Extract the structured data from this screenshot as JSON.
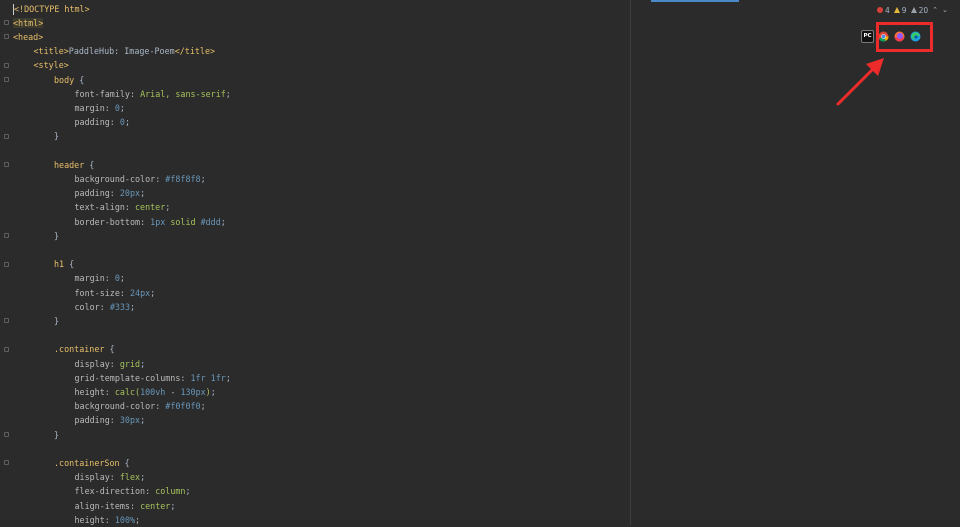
{
  "editor": {
    "lines": [
      {
        "indent": 0,
        "tokens": [
          {
            "t": "<!DOCTYPE html>",
            "c": "t-doc"
          }
        ],
        "cursor": true
      },
      {
        "indent": 0,
        "tokens": [
          {
            "t": "<html>",
            "c": "t-tagbg"
          }
        ]
      },
      {
        "indent": 0,
        "tokens": [
          {
            "t": "<head>",
            "c": "t-tag"
          }
        ]
      },
      {
        "indent": 1,
        "tokens": [
          {
            "t": "<title>",
            "c": "t-tag"
          },
          {
            "t": "PaddleHub: Image-Poem",
            "c": "t-plain"
          },
          {
            "t": "</title>",
            "c": "t-tag"
          }
        ]
      },
      {
        "indent": 1,
        "tokens": [
          {
            "t": "<style>",
            "c": "t-tag"
          }
        ]
      },
      {
        "indent": 2,
        "tokens": [
          {
            "t": "body",
            "c": "t-sel"
          },
          {
            "t": " {",
            "c": "t-plain"
          }
        ]
      },
      {
        "indent": 3,
        "tokens": [
          {
            "t": "font-family",
            "c": "t-prop"
          },
          {
            "t": ": ",
            "c": "t-plain"
          },
          {
            "t": "Arial, sans-serif",
            "c": "t-val"
          },
          {
            "t": ";",
            "c": "t-plain"
          }
        ]
      },
      {
        "indent": 3,
        "tokens": [
          {
            "t": "margin",
            "c": "t-prop"
          },
          {
            "t": ": ",
            "c": "t-plain"
          },
          {
            "t": "0",
            "c": "t-num"
          },
          {
            "t": ";",
            "c": "t-plain"
          }
        ]
      },
      {
        "indent": 3,
        "tokens": [
          {
            "t": "padding",
            "c": "t-prop"
          },
          {
            "t": ": ",
            "c": "t-plain"
          },
          {
            "t": "0",
            "c": "t-num"
          },
          {
            "t": ";",
            "c": "t-plain"
          }
        ]
      },
      {
        "indent": 2,
        "tokens": [
          {
            "t": "}",
            "c": "t-plain"
          }
        ]
      },
      {
        "indent": 0,
        "tokens": []
      },
      {
        "indent": 2,
        "tokens": [
          {
            "t": "header",
            "c": "t-sel"
          },
          {
            "t": " {",
            "c": "t-plain"
          }
        ]
      },
      {
        "indent": 3,
        "tokens": [
          {
            "t": "background-color",
            "c": "t-prop"
          },
          {
            "t": ": ",
            "c": "t-plain"
          },
          {
            "t": "#f8f8f8",
            "c": "t-num"
          },
          {
            "t": ";",
            "c": "t-plain"
          }
        ]
      },
      {
        "indent": 3,
        "tokens": [
          {
            "t": "padding",
            "c": "t-prop"
          },
          {
            "t": ": ",
            "c": "t-plain"
          },
          {
            "t": "20px",
            "c": "t-num"
          },
          {
            "t": ";",
            "c": "t-plain"
          }
        ]
      },
      {
        "indent": 3,
        "tokens": [
          {
            "t": "text-align",
            "c": "t-prop"
          },
          {
            "t": ": ",
            "c": "t-plain"
          },
          {
            "t": "center",
            "c": "t-val"
          },
          {
            "t": ";",
            "c": "t-plain"
          }
        ]
      },
      {
        "indent": 3,
        "tokens": [
          {
            "t": "border-bottom",
            "c": "t-prop"
          },
          {
            "t": ": ",
            "c": "t-plain"
          },
          {
            "t": "1px",
            "c": "t-num"
          },
          {
            "t": " solid ",
            "c": "t-val"
          },
          {
            "t": "#ddd",
            "c": "t-num"
          },
          {
            "t": ";",
            "c": "t-plain"
          }
        ]
      },
      {
        "indent": 2,
        "tokens": [
          {
            "t": "}",
            "c": "t-plain"
          }
        ]
      },
      {
        "indent": 0,
        "tokens": []
      },
      {
        "indent": 2,
        "tokens": [
          {
            "t": "h1",
            "c": "t-sel"
          },
          {
            "t": " {",
            "c": "t-plain"
          }
        ]
      },
      {
        "indent": 3,
        "tokens": [
          {
            "t": "margin",
            "c": "t-prop"
          },
          {
            "t": ": ",
            "c": "t-plain"
          },
          {
            "t": "0",
            "c": "t-num"
          },
          {
            "t": ";",
            "c": "t-plain"
          }
        ]
      },
      {
        "indent": 3,
        "tokens": [
          {
            "t": "font-size",
            "c": "t-prop"
          },
          {
            "t": ": ",
            "c": "t-plain"
          },
          {
            "t": "24px",
            "c": "t-num"
          },
          {
            "t": ";",
            "c": "t-plain"
          }
        ]
      },
      {
        "indent": 3,
        "tokens": [
          {
            "t": "color",
            "c": "t-prop"
          },
          {
            "t": ": ",
            "c": "t-plain"
          },
          {
            "t": "#333",
            "c": "t-num"
          },
          {
            "t": ";",
            "c": "t-plain"
          }
        ]
      },
      {
        "indent": 2,
        "tokens": [
          {
            "t": "}",
            "c": "t-plain"
          }
        ]
      },
      {
        "indent": 0,
        "tokens": []
      },
      {
        "indent": 2,
        "tokens": [
          {
            "t": ".container",
            "c": "t-sel"
          },
          {
            "t": " {",
            "c": "t-plain"
          }
        ]
      },
      {
        "indent": 3,
        "tokens": [
          {
            "t": "display",
            "c": "t-prop"
          },
          {
            "t": ": ",
            "c": "t-plain"
          },
          {
            "t": "grid",
            "c": "t-val"
          },
          {
            "t": ";",
            "c": "t-plain"
          }
        ]
      },
      {
        "indent": 3,
        "tokens": [
          {
            "t": "grid-template-columns",
            "c": "t-prop"
          },
          {
            "t": ": ",
            "c": "t-plain"
          },
          {
            "t": "1fr",
            "c": "t-num"
          },
          {
            "t": " ",
            "c": "t-plain"
          },
          {
            "t": "1fr",
            "c": "t-num"
          },
          {
            "t": ";",
            "c": "t-plain"
          }
        ]
      },
      {
        "indent": 3,
        "tokens": [
          {
            "t": "height",
            "c": "t-prop"
          },
          {
            "t": ": ",
            "c": "t-plain"
          },
          {
            "t": "calc(",
            "c": "t-val"
          },
          {
            "t": "100vh",
            "c": "t-num"
          },
          {
            "t": " - ",
            "c": "t-plain"
          },
          {
            "t": "130px",
            "c": "t-num"
          },
          {
            "t": ")",
            "c": "t-val"
          },
          {
            "t": ";",
            "c": "t-plain"
          }
        ]
      },
      {
        "indent": 3,
        "tokens": [
          {
            "t": "background-color",
            "c": "t-prop"
          },
          {
            "t": ": ",
            "c": "t-plain"
          },
          {
            "t": "#f0f0f0",
            "c": "t-num"
          },
          {
            "t": ";",
            "c": "t-plain"
          }
        ]
      },
      {
        "indent": 3,
        "tokens": [
          {
            "t": "padding",
            "c": "t-prop"
          },
          {
            "t": ": ",
            "c": "t-plain"
          },
          {
            "t": "30px",
            "c": "t-num"
          },
          {
            "t": ";",
            "c": "t-plain"
          }
        ]
      },
      {
        "indent": 2,
        "tokens": [
          {
            "t": "}",
            "c": "t-plain"
          }
        ]
      },
      {
        "indent": 0,
        "tokens": []
      },
      {
        "indent": 2,
        "tokens": [
          {
            "t": ".containerSon",
            "c": "t-sel"
          },
          {
            "t": " {",
            "c": "t-plain"
          }
        ]
      },
      {
        "indent": 3,
        "tokens": [
          {
            "t": "display",
            "c": "t-prop"
          },
          {
            "t": ": ",
            "c": "t-plain"
          },
          {
            "t": "flex",
            "c": "t-val"
          },
          {
            "t": ";",
            "c": "t-plain"
          }
        ]
      },
      {
        "indent": 3,
        "tokens": [
          {
            "t": "flex-direction",
            "c": "t-prop"
          },
          {
            "t": ": ",
            "c": "t-plain"
          },
          {
            "t": "column",
            "c": "t-val"
          },
          {
            "t": ";",
            "c": "t-plain"
          }
        ]
      },
      {
        "indent": 3,
        "tokens": [
          {
            "t": "align-items",
            "c": "t-prop"
          },
          {
            "t": ": ",
            "c": "t-plain"
          },
          {
            "t": "center",
            "c": "t-val"
          },
          {
            "t": ";",
            "c": "t-plain"
          }
        ]
      },
      {
        "indent": 3,
        "tokens": [
          {
            "t": "height",
            "c": "t-prop"
          },
          {
            "t": ": ",
            "c": "t-plain"
          },
          {
            "t": "100%",
            "c": "t-num"
          },
          {
            "t": ";",
            "c": "t-plain"
          }
        ]
      }
    ]
  },
  "inspection": {
    "errors": "4",
    "warnings": "9",
    "weak_warnings": "20",
    "error_icon": "error-circle-icon",
    "warning_icon": "warning-triangle-icon",
    "weak_warning_icon": "weak-warning-triangle-icon",
    "nav_icons": [
      "chevron-up-icon",
      "chevron-down-icon"
    ]
  },
  "browser_icons": [
    {
      "name": "pycharm-icon",
      "label": "PC"
    },
    {
      "name": "chrome-icon"
    },
    {
      "name": "firefox-icon"
    },
    {
      "name": "edge-icon"
    }
  ],
  "annotation": {
    "highlight_color": "#ee2b2b",
    "arrow_icon": "red-arrow-icon"
  },
  "colors": {
    "background": "#2b2b2b",
    "tag": "#e8bf6a",
    "string_value": "#a5c25c",
    "number": "#6897bb",
    "text": "#a9b7c6"
  }
}
